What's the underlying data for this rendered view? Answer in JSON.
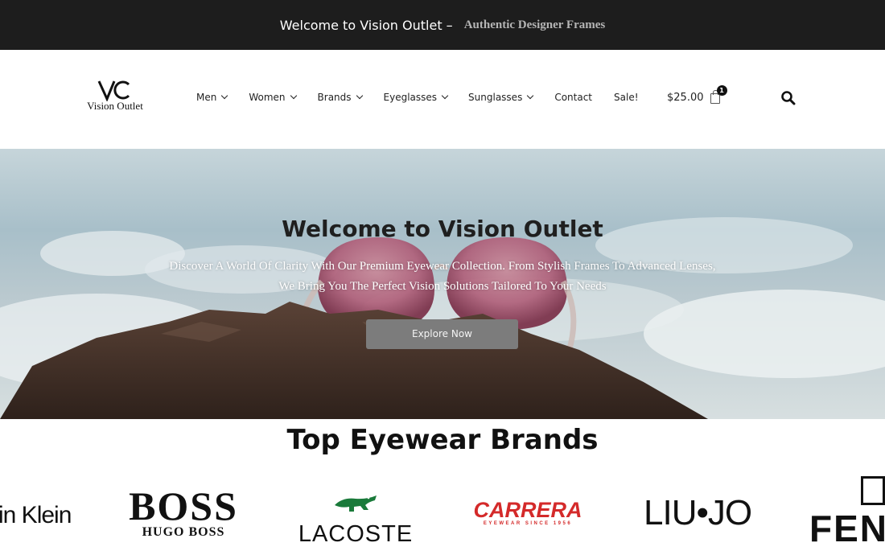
{
  "topbar": {
    "welcome": "Welcome to Vision Outlet –",
    "tagline": "Authentic Designer Frames"
  },
  "header": {
    "logo_text": "Vision Outlet",
    "nav": [
      {
        "label": "Men",
        "dropdown": true
      },
      {
        "label": "Women",
        "dropdown": true
      },
      {
        "label": "Brands",
        "dropdown": true
      },
      {
        "label": "Eyeglasses",
        "dropdown": true
      },
      {
        "label": "Sunglasses",
        "dropdown": true
      },
      {
        "label": "Contact",
        "dropdown": false
      },
      {
        "label": "Sale!",
        "dropdown": false
      }
    ],
    "cart": {
      "total": "$25.00",
      "count": "1"
    },
    "search_icon": "search-icon"
  },
  "hero": {
    "title": "Welcome to Vision Outlet",
    "subtitle_line1": "Discover A World Of Clarity With Our Premium Eyewear Collection. From Stylish Frames To Advanced Lenses,",
    "subtitle_line2": "We Bring You The Perfect Vision Solutions Tailored To Your Needs",
    "button": "Explore Now"
  },
  "brands": {
    "title": "Top Eyewear Brands",
    "items": {
      "calvin_klein": "in Klein",
      "boss": "BOSS",
      "boss_sub": "HUGO BOSS",
      "lacoste": "LACOSTE",
      "carrera": "CARRERA",
      "carrera_sub": "EYEWEAR SINCE 1956",
      "liujo": "LIU•JO",
      "fendi": "FEN"
    }
  },
  "colors": {
    "topbar_bg": "#1d1d1d",
    "accent_red": "#d42a2a",
    "lacoste_green": "#1a7a3a",
    "button_gray": "#7c7c7c"
  }
}
